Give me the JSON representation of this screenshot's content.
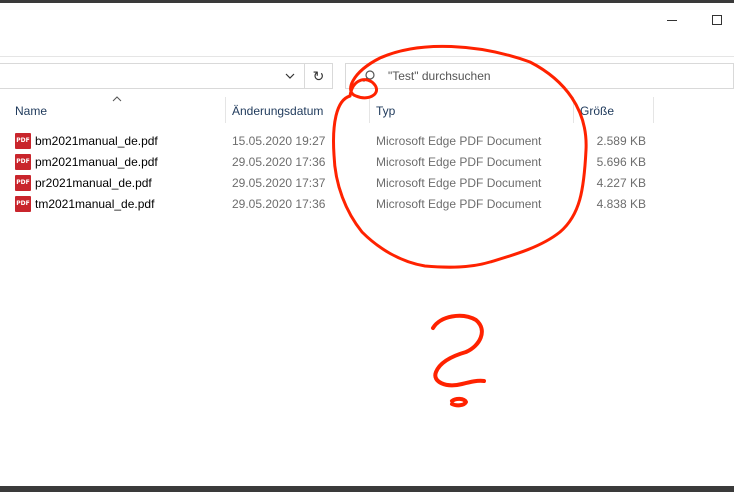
{
  "window": {
    "minimize_icon": "minimize-icon",
    "maximize_icon": "maximize-icon"
  },
  "toolbar": {
    "refresh_icon": "refresh-icon",
    "refresh_glyph": "↻",
    "chevron_icon": "chevron-down-icon"
  },
  "search": {
    "placeholder": "\"Test\" durchsuchen",
    "icon": "search-icon"
  },
  "columns": {
    "name": "Name",
    "date": "Änderungsdatum",
    "type": "Typ",
    "size": "Größe",
    "sort": "ascending"
  },
  "files": [
    {
      "icon_label": "PDF",
      "name": "bm2021manual_de.pdf",
      "date": "15.05.2020 19:27",
      "type": "Microsoft Edge PDF Document",
      "size": "2.589 KB"
    },
    {
      "icon_label": "PDF",
      "name": "pm2021manual_de.pdf",
      "date": "29.05.2020 17:36",
      "type": "Microsoft Edge PDF Document",
      "size": "5.696 KB"
    },
    {
      "icon_label": "PDF",
      "name": "pr2021manual_de.pdf",
      "date": "29.05.2020 17:37",
      "type": "Microsoft Edge PDF Document",
      "size": "4.227 KB"
    },
    {
      "icon_label": "PDF",
      "name": "tm2021manual_de.pdf",
      "date": "29.05.2020 17:36",
      "type": "Microsoft Edge PDF Document",
      "size": "4.838 KB"
    }
  ],
  "annotation": {
    "color": "#ff2200",
    "shapes": [
      "circle",
      "question-mark"
    ]
  },
  "colors": {
    "header_text": "#1e395b",
    "muted_text": "#6d6d6d",
    "pdf_icon": "#c9252c"
  }
}
